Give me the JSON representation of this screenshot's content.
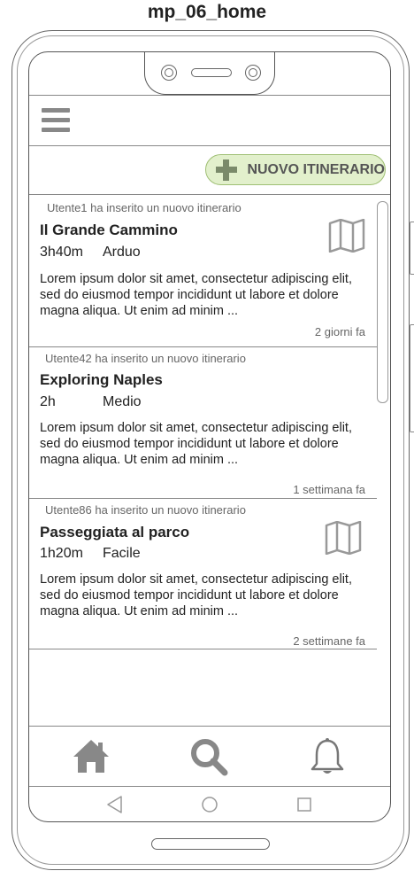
{
  "page": {
    "title": "mp_06_home"
  },
  "header": {
    "menu_icon": "hamburger-menu-icon"
  },
  "actions": {
    "new_itinerary_label": "NUOVO ITINERARIO",
    "new_itinerary_icon": "plus-icon",
    "accent_color": "#e2f0cc"
  },
  "feed": {
    "items": [
      {
        "meta": "Utente1 ha inserito un nuovo itinerario",
        "title": "Il Grande Cammino",
        "duration": "3h40m",
        "difficulty": "Arduo",
        "description": "Lorem ipsum dolor sit amet, consectetur adipiscing elit, sed do eiusmod tempor incididunt ut labore et dolore magna aliqua. Ut enim ad minim ...",
        "time_ago": "2 giorni fa",
        "icon": "map-icon"
      },
      {
        "meta": "Utente42 ha inserito un nuovo itinerario",
        "title": "Exploring Naples",
        "duration": "2h",
        "difficulty": "Medio",
        "description": "Lorem ipsum dolor sit amet, consectetur adipiscing elit, sed do eiusmod tempor incididunt ut labore et dolore magna aliqua. Ut enim ad minim ...",
        "time_ago": "1 settimana fa"
      },
      {
        "meta": "Utente86 ha inserito un nuovo itinerario",
        "title": "Passeggiata al parco",
        "duration": "1h20m",
        "difficulty": "Facile",
        "description": "Lorem ipsum dolor sit amet, consectetur adipiscing elit, sed do eiusmod tempor incididunt ut labore et dolore magna aliqua. Ut enim ad minim ...",
        "time_ago": "2 settimane fa",
        "icon": "map-icon"
      }
    ]
  },
  "bottom_nav": {
    "items": [
      "home-icon",
      "search-icon",
      "bell-icon"
    ]
  },
  "system_nav": {
    "items": [
      "back-icon",
      "home-circle-icon",
      "recents-icon"
    ]
  }
}
